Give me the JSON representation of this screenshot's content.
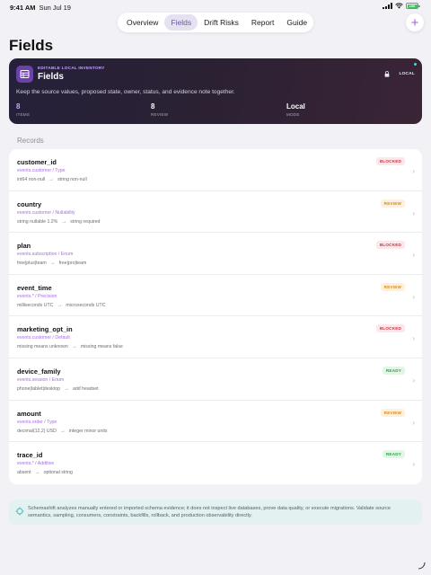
{
  "status_bar": {
    "time": "9:41 AM",
    "date": "Sun Jul 19",
    "battery": "100"
  },
  "nav": {
    "tabs": [
      {
        "label": "Overview",
        "active": false
      },
      {
        "label": "Fields",
        "active": true
      },
      {
        "label": "Drift Risks",
        "active": false
      },
      {
        "label": "Report",
        "active": false
      },
      {
        "label": "Guide",
        "active": false
      }
    ],
    "add_label": "+"
  },
  "page": {
    "title": "Fields"
  },
  "hero": {
    "eyebrow": "EDITABLE LOCAL INVENTORY",
    "title": "Fields",
    "mode_badge": "LOCAL",
    "description": "Keep the source values, proposed state, owner, status, and evidence note together.",
    "stats": [
      {
        "value": "8",
        "label": "ITEMS",
        "accent": true
      },
      {
        "value": "8",
        "label": "REVIEW",
        "accent": false
      },
      {
        "value": "Local",
        "label": "MODE",
        "accent": false
      }
    ]
  },
  "records": {
    "section_label": "Records",
    "items": [
      {
        "name": "customer_id",
        "path": "events.customer / Type",
        "from": "int64 non-null",
        "to": "string non-null",
        "status": "BLOCKED",
        "tone": "blocked"
      },
      {
        "name": "country",
        "path": "events.customer / Nullability",
        "from": "string nullable 1.2%",
        "to": "string required",
        "status": "REVIEW",
        "tone": "review"
      },
      {
        "name": "plan",
        "path": "events.subscription / Enum",
        "from": "free|plus|team",
        "to": "free|pro|team",
        "status": "BLOCKED",
        "tone": "blocked"
      },
      {
        "name": "event_time",
        "path": "events.* / Precision",
        "from": "milliseconds UTC",
        "to": "microseconds UTC",
        "status": "REVIEW",
        "tone": "review"
      },
      {
        "name": "marketing_opt_in",
        "path": "events.customer / Default",
        "from": "missing means unknown",
        "to": "missing means false",
        "status": "BLOCKED",
        "tone": "blocked"
      },
      {
        "name": "device_family",
        "path": "events.session / Enum",
        "from": "phone|tablet|desktop",
        "to": "add headset",
        "status": "READY",
        "tone": "ready"
      },
      {
        "name": "amount",
        "path": "events.order / Type",
        "from": "decimal(12,2) USD",
        "to": "integer minor units",
        "status": "REVIEW",
        "tone": "review"
      },
      {
        "name": "trace_id",
        "path": "events.* / Additive",
        "from": "absent",
        "to": "optional string",
        "status": "READY",
        "tone": "ready"
      }
    ]
  },
  "note": {
    "text": "Schemashift analyzes manually entered or imported schema evidence; it does not inspect live databases, prove data quality, or execute migrations. Validate source semantics, sampling, consumers, constraints, backfills, rollback, and production observability directly."
  },
  "colors": {
    "accent": "#9b63d6",
    "blocked": "#d0323f",
    "review": "#d98a1d",
    "ready": "#2e9e48"
  }
}
